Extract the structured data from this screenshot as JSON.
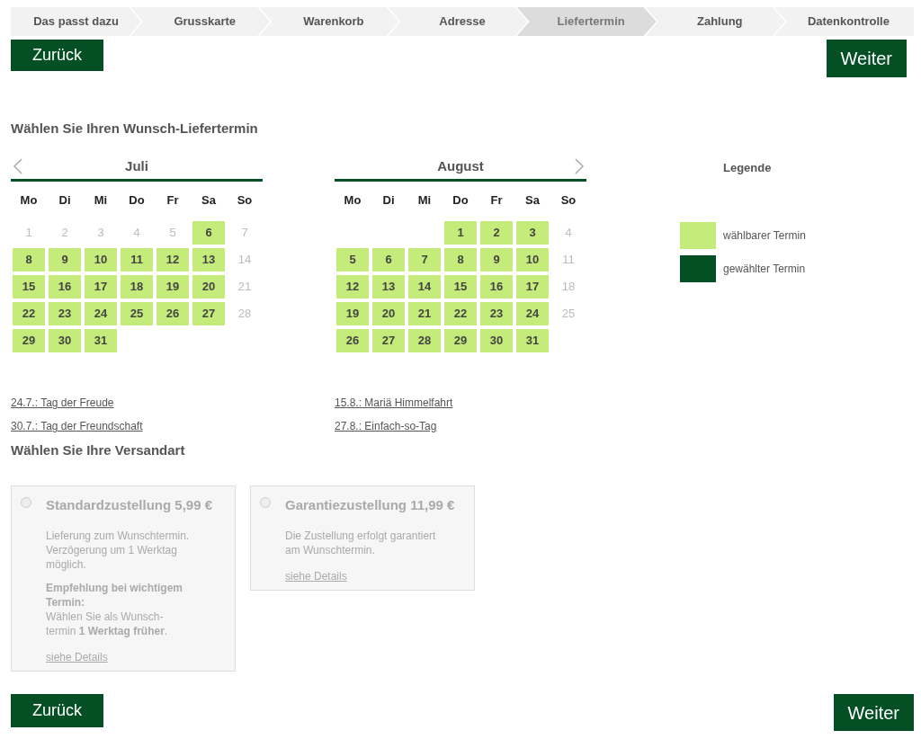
{
  "steps": [
    {
      "label": "Das passt dazu",
      "selected": false
    },
    {
      "label": "Grusskarte",
      "selected": false
    },
    {
      "label": "Warenkorb",
      "selected": false
    },
    {
      "label": "Adresse",
      "selected": false
    },
    {
      "label": "Liefertermin",
      "selected": true
    },
    {
      "label": "Zahlung",
      "selected": false
    },
    {
      "label": "Datenkontrolle",
      "selected": false
    }
  ],
  "top_buttons": {
    "back": "Zurück",
    "next": "Weiter"
  },
  "date_heading": "Wählen Sie Ihren Wunsch-Liefertermin",
  "months": [
    {
      "name": "Juli",
      "prev_arrow": true,
      "next_arrow": false,
      "weekdays": [
        "Mo",
        "Di",
        "Mi",
        "Do",
        "Fr",
        "Sa",
        "So"
      ],
      "days": [
        {
          "kind": "day",
          "day": "1",
          "selectable": false
        },
        {
          "kind": "day",
          "day": "2",
          "selectable": false
        },
        {
          "kind": "day",
          "day": "3",
          "selectable": false
        },
        {
          "kind": "day",
          "day": "4",
          "selectable": false
        },
        {
          "kind": "day",
          "day": "5",
          "selectable": false
        },
        {
          "kind": "day",
          "day": "6",
          "selectable": true
        },
        {
          "kind": "day",
          "day": "7",
          "selectable": false
        },
        {
          "kind": "day",
          "day": "8",
          "selectable": true
        },
        {
          "kind": "day",
          "day": "9",
          "selectable": true
        },
        {
          "kind": "day",
          "day": "10",
          "selectable": true
        },
        {
          "kind": "day",
          "day": "11",
          "selectable": true
        },
        {
          "kind": "day",
          "day": "12",
          "selectable": true
        },
        {
          "kind": "day",
          "day": "13",
          "selectable": true
        },
        {
          "kind": "day",
          "day": "14",
          "selectable": false
        },
        {
          "kind": "day",
          "day": "15",
          "selectable": true
        },
        {
          "kind": "day",
          "day": "16",
          "selectable": true
        },
        {
          "kind": "day",
          "day": "17",
          "selectable": true
        },
        {
          "kind": "day",
          "day": "18",
          "selectable": true
        },
        {
          "kind": "day",
          "day": "19",
          "selectable": true
        },
        {
          "kind": "day",
          "day": "20",
          "selectable": true
        },
        {
          "kind": "day",
          "day": "21",
          "selectable": false
        },
        {
          "kind": "day",
          "day": "22",
          "selectable": true
        },
        {
          "kind": "day",
          "day": "23",
          "selectable": true
        },
        {
          "kind": "day",
          "day": "24",
          "selectable": true
        },
        {
          "kind": "day",
          "day": "25",
          "selectable": true
        },
        {
          "kind": "day",
          "day": "26",
          "selectable": true
        },
        {
          "kind": "day",
          "day": "27",
          "selectable": true
        },
        {
          "kind": "day",
          "day": "28",
          "selectable": false
        },
        {
          "kind": "day",
          "day": "29",
          "selectable": true
        },
        {
          "kind": "day",
          "day": "30",
          "selectable": true
        },
        {
          "kind": "day",
          "day": "31",
          "selectable": true
        }
      ],
      "holidays": [
        "24.7.: Tag der Freude",
        "30.7.: Tag der Freundschaft"
      ]
    },
    {
      "name": "August",
      "prev_arrow": false,
      "next_arrow": true,
      "weekdays": [
        "Mo",
        "Di",
        "Mi",
        "Do",
        "Fr",
        "Sa",
        "So"
      ],
      "days": [
        {
          "kind": "blank"
        },
        {
          "kind": "blank"
        },
        {
          "kind": "blank"
        },
        {
          "kind": "day",
          "day": "1",
          "selectable": true
        },
        {
          "kind": "day",
          "day": "2",
          "selectable": true
        },
        {
          "kind": "day",
          "day": "3",
          "selectable": true
        },
        {
          "kind": "day",
          "day": "4",
          "selectable": false
        },
        {
          "kind": "day",
          "day": "5",
          "selectable": true
        },
        {
          "kind": "day",
          "day": "6",
          "selectable": true
        },
        {
          "kind": "day",
          "day": "7",
          "selectable": true
        },
        {
          "kind": "day",
          "day": "8",
          "selectable": true
        },
        {
          "kind": "day",
          "day": "9",
          "selectable": true
        },
        {
          "kind": "day",
          "day": "10",
          "selectable": true
        },
        {
          "kind": "day",
          "day": "11",
          "selectable": false
        },
        {
          "kind": "day",
          "day": "12",
          "selectable": true
        },
        {
          "kind": "day",
          "day": "13",
          "selectable": true
        },
        {
          "kind": "day",
          "day": "14",
          "selectable": true
        },
        {
          "kind": "day",
          "day": "15",
          "selectable": true
        },
        {
          "kind": "day",
          "day": "16",
          "selectable": true
        },
        {
          "kind": "day",
          "day": "17",
          "selectable": true
        },
        {
          "kind": "day",
          "day": "18",
          "selectable": false
        },
        {
          "kind": "day",
          "day": "19",
          "selectable": true
        },
        {
          "kind": "day",
          "day": "20",
          "selectable": true
        },
        {
          "kind": "day",
          "day": "21",
          "selectable": true
        },
        {
          "kind": "day",
          "day": "22",
          "selectable": true
        },
        {
          "kind": "day",
          "day": "23",
          "selectable": true
        },
        {
          "kind": "day",
          "day": "24",
          "selectable": true
        },
        {
          "kind": "day",
          "day": "25",
          "selectable": false
        },
        {
          "kind": "day",
          "day": "26",
          "selectable": true
        },
        {
          "kind": "day",
          "day": "27",
          "selectable": true
        },
        {
          "kind": "day",
          "day": "28",
          "selectable": true
        },
        {
          "kind": "day",
          "day": "29",
          "selectable": true
        },
        {
          "kind": "day",
          "day": "30",
          "selectable": true
        },
        {
          "kind": "day",
          "day": "31",
          "selectable": true
        }
      ],
      "holidays": [
        "15.8.: Mariä Himmelfahrt",
        "27.8.: Einfach-so-Tag"
      ]
    }
  ],
  "legend": {
    "title": "Legende",
    "items": [
      {
        "label": "wählbarer Termin",
        "color": "#c5eb7a"
      },
      {
        "label": "gewählter Termin",
        "color": "#044f24"
      }
    ]
  },
  "shipping_heading": "Wählen Sie Ihre Versandart",
  "shipping_options": [
    {
      "title": "Standardzustellung 5,99 €",
      "selected": false,
      "disabled": true,
      "description": "Lieferung zum Wunschtermin. Verzögerung um 1 Werktag möglich.",
      "note_title": "Empfehlung bei wichtigem Termin:",
      "note": "Wählen Sie als Wunsch-termin **1 Werktag früher**.",
      "link": "siehe Details"
    },
    {
      "title": "Garantiezustellung 11,99 €",
      "selected": false,
      "disabled": true,
      "description": "Die Zustellung erfolgt garantiert am Wunschtermin.",
      "link": "siehe Details"
    }
  ],
  "bottom_buttons": {
    "back": "Zurück",
    "next": "Weiter"
  }
}
